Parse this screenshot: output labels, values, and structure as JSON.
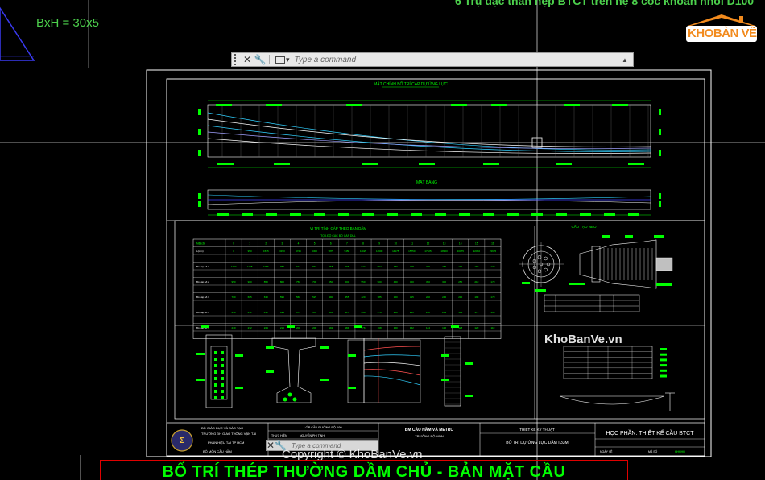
{
  "drawing": {
    "top_note": "6 Trụ đặc thân hẹp BTCT trên hệ 8 cọc khoan nhồi D100",
    "bxh_label": "BxH = 30x5",
    "plan_title": "MẶT BẰNG",
    "elevation_title": "MẶT CHÍNH BỐ TRÍ CÁP DỰ ỨNG LỰC",
    "table_title": "VỊ TRÍ TÍNH CÁP THEO BẢN DẦM",
    "table_subtitle": "TỌA ĐỘ CÁC BÓ CÁP DUL",
    "anchor_title": "CẤU TẠO NEO",
    "main_title": "BỐ TRÍ THÉP THƯỜNG DẦM CHỦ - BẢN MẶT CẦU",
    "title_block": {
      "ministry": "BỘ GIÁO DỤC VÀ ĐÀO TẠO",
      "university": "TRƯỜNG ĐH GIAO THÔNG VẬN TẢI",
      "campus": "PHÂN HIỆU TẠI TP HCM",
      "department": "BỘ MÔN CẦU HẦM",
      "class_label": "LỚP CẦU ĐƯỜNG BỘ K60",
      "designer_label": "THỰC HIỆN",
      "designer_name": "NGUYỄN PHI TÌNH",
      "advisor_label": "HƯỚNG DẪN",
      "dept_name": "BM CẦU HẦM VÀ METRO",
      "dept_head": "TRƯỞNG BỘ MÔN",
      "design_type": "THIẾT KẾ KỸ THUẬT",
      "sheet_title": "BỐ TRÍ DỰ ỨNG LỰC DẦM I 33M",
      "course": "HỌC PHẦN: THIẾT KẾ CẦU BTCT",
      "date_label": "NGÀY VẼ",
      "code_label": "MÃ SỐ",
      "sheet_no": "HHHHH"
    }
  },
  "command_line": {
    "placeholder": "Type a command",
    "prompt_label": "▾",
    "close_label": "✕",
    "settings_label": "🔧",
    "history_label": "▲"
  },
  "watermarks": {
    "main": "KhoBanVe.vn",
    "copyright": "Copyright © KhoBanVe.vn"
  },
  "logo": {
    "part1": "KHO",
    "part2": "BẢN VẼ"
  },
  "colors": {
    "background": "#000000",
    "cad_green": "#00ff00",
    "cad_frame": "#ffffff",
    "accent_red": "#e00000",
    "logo_orange": "#f28b1e"
  },
  "cable_table": {
    "headers": [
      "Mặt cắt",
      "0",
      "1",
      "2",
      "3",
      "4",
      "5",
      "6",
      "7",
      "8",
      "9",
      "10",
      "11",
      "12",
      "13",
      "14",
      "15",
      "16"
    ],
    "rows": [
      [
        "L(mm)",
        "0",
        "950",
        "1575",
        "3150",
        "4725",
        "6300",
        "7875",
        "9450",
        "11025",
        "12600",
        "14175",
        "15750",
        "17325",
        "18900",
        "20475",
        "22050",
        "23625"
      ],
      [
        "Bó cáp số 1",
        "1200",
        "1128",
        "1056",
        "984",
        "912",
        "840",
        "768",
        "696",
        "624",
        "552",
        "480",
        "408",
        "336",
        "264",
        "192",
        "160",
        "130"
      ],
      [
        "Bó cáp số 2",
        "950",
        "900",
        "850",
        "800",
        "750",
        "700",
        "650",
        "600",
        "550",
        "500",
        "450",
        "400",
        "350",
        "300",
        "250",
        "210",
        "170"
      ],
      [
        "Bó cáp số 3",
        "700",
        "665",
        "630",
        "595",
        "560",
        "525",
        "490",
        "455",
        "420",
        "385",
        "350",
        "315",
        "280",
        "245",
        "210",
        "190",
        "170"
      ],
      [
        "Bó cáp số 4",
        "450",
        "431",
        "412",
        "393",
        "374",
        "355",
        "336",
        "317",
        "298",
        "279",
        "260",
        "241",
        "222",
        "203",
        "184",
        "172",
        "160"
      ],
      [
        "Bó cáp số 5",
        "240",
        "232",
        "224",
        "216",
        "208",
        "200",
        "192",
        "184",
        "176",
        "168",
        "160",
        "152",
        "144",
        "136",
        "128",
        "120",
        "110"
      ]
    ]
  }
}
